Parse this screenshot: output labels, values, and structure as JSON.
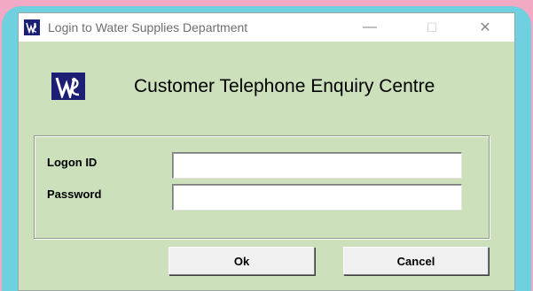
{
  "window": {
    "title": "Login to Water Supplies Department",
    "controls": {
      "minimize": "—",
      "maximize": "☐",
      "close": "✕"
    },
    "icon": "wsd-logo-icon"
  },
  "header": {
    "logo_icon": "wsd-logo-icon",
    "title": "Customer Telephone Enquiry Centre"
  },
  "form": {
    "logon_label": "Logon ID",
    "logon_value": "",
    "password_label": "Password",
    "password_value": ""
  },
  "buttons": {
    "ok_label": "Ok",
    "cancel_label": "Cancel"
  },
  "colors": {
    "dialog_background": "#cbe0bb",
    "logo_background": "#1c1f73",
    "backdrop_pink": "#f2a9c3",
    "backdrop_blue": "#6fd0e0"
  }
}
